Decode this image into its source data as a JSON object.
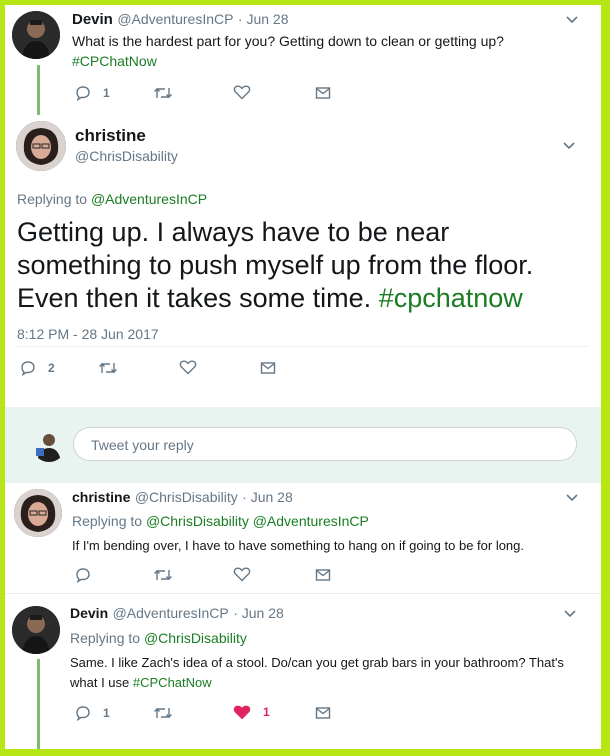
{
  "tweets": [
    {
      "name": "Devin",
      "handle": "@AdventuresInCP",
      "date": "· Jun 28",
      "text": "What is the hardest part for you? Getting down to clean or getting up?",
      "hashtag": "#CPChatNow",
      "reply_count": "1",
      "retweet_count": "",
      "like_count": ""
    },
    {
      "name": "christine",
      "handle": "@ChrisDisability",
      "replying_prefix": "Replying to",
      "replying_to": "@AdventuresInCP",
      "text": "Getting up. I always have to be near something to push myself up from the floor. Even then it takes some time.",
      "hashtag": "#cpchatnow",
      "timestamp": "8:12 PM - 28 Jun 2017",
      "reply_count": "2"
    },
    {
      "name": "christine",
      "handle": "@ChrisDisability",
      "date": "· Jun 28",
      "replying_prefix": "Replying to",
      "replying_to": "@ChrisDisability @AdventuresInCP",
      "text": "If I'm bending over, I have to have something to hang on if going to be for long."
    },
    {
      "name": "Devin",
      "handle": "@AdventuresInCP",
      "date": "· Jun 28",
      "replying_prefix": "Replying to",
      "replying_to": "@ChrisDisability",
      "text": "Same. I like Zach's idea of a stool. Do/can you get grab bars in your bathroom? That's what I use",
      "hashtag": "#CPChatNow",
      "reply_count": "1",
      "like_count": "1"
    }
  ],
  "reply_box": {
    "placeholder": "Tweet your reply"
  },
  "colors": {
    "accent_green": "#1a7d23",
    "thread_line": "#7fba6e",
    "like_red": "#e0245e",
    "frame": "#b6e614"
  },
  "icons": [
    "reply-icon",
    "retweet-icon",
    "heart-icon",
    "mail-icon",
    "chevron-down-icon"
  ]
}
